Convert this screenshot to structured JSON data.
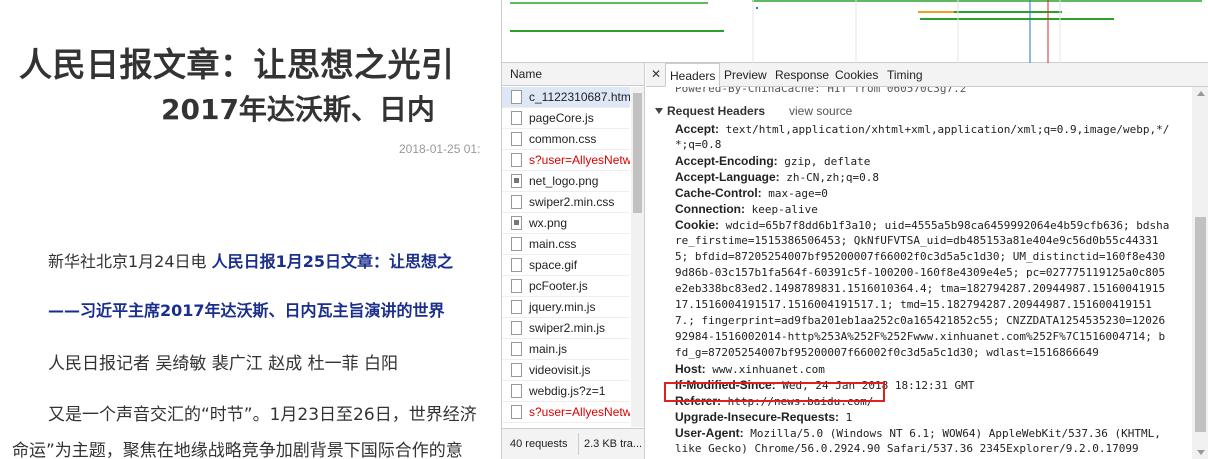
{
  "article": {
    "title_line1": "人民日报文章：让思想之光引",
    "title_line2": "2017年达沃斯、日内",
    "date": "2018-01-25 01:",
    "p1_prefix": "新华社北京1月24日电 ",
    "p1_link": "人民日报1月25日文章：让思想之",
    "p2": "——习近平主席2017年达沃斯、日内瓦主旨演讲的世界",
    "p3": "人民日报记者 吴绮敏 裴广江 赵成 杜一菲 白阳",
    "p4": "又是一个声音交汇的“时节”。1月23日至26日，世界经济",
    "p5": "命运”为主题，聚焦在地缘战略竞争加剧背景下国际合作的意"
  },
  "devtools": {
    "network_list": {
      "header": "Name",
      "rows": [
        {
          "name": "c_1122310687.htm",
          "selected": true,
          "error": false,
          "icon": "document-icon"
        },
        {
          "name": "pageCore.js",
          "selected": false,
          "error": false,
          "icon": "document-icon"
        },
        {
          "name": "common.css",
          "selected": false,
          "error": false,
          "icon": "document-icon"
        },
        {
          "name": "s?user=AllyesNetw",
          "selected": false,
          "error": true,
          "icon": "document-icon"
        },
        {
          "name": "net_logo.png",
          "selected": false,
          "error": false,
          "icon": "image-icon"
        },
        {
          "name": "swiper2.min.css",
          "selected": false,
          "error": false,
          "icon": "document-icon"
        },
        {
          "name": "wx.png",
          "selected": false,
          "error": false,
          "icon": "image-icon"
        },
        {
          "name": "main.css",
          "selected": false,
          "error": false,
          "icon": "document-icon"
        },
        {
          "name": "space.gif",
          "selected": false,
          "error": false,
          "icon": "document-icon"
        },
        {
          "name": "pcFooter.js",
          "selected": false,
          "error": false,
          "icon": "document-icon"
        },
        {
          "name": "jquery.min.js",
          "selected": false,
          "error": false,
          "icon": "document-icon"
        },
        {
          "name": "swiper2.min.js",
          "selected": false,
          "error": false,
          "icon": "document-icon"
        },
        {
          "name": "main.js",
          "selected": false,
          "error": false,
          "icon": "document-icon"
        },
        {
          "name": "videovisit.js",
          "selected": false,
          "error": false,
          "icon": "document-icon"
        },
        {
          "name": "webdig.js?z=1",
          "selected": false,
          "error": false,
          "icon": "document-icon"
        },
        {
          "name": "s?user=AllyesNetw",
          "selected": false,
          "error": true,
          "icon": "document-icon"
        }
      ],
      "footer_requests": "40 requests",
      "footer_transferred": "2.3 KB tra..."
    },
    "tabs": [
      "Headers",
      "Preview",
      "Response",
      "Cookies",
      "Timing"
    ],
    "active_tab": "Headers",
    "close_glyph": "✕",
    "headers": {
      "partial_top_line": "Powered-By-ChinaCache: HIT from 060570c3g7.2",
      "section_title": "Request Headers",
      "view_source": "view source",
      "accept_key": "Accept:",
      "accept_value_1": " text/html,application/xhtml+xml,application/xml;q=0.9,image/webp,*/",
      "accept_value_2": "*;q=0.8",
      "encoding_key": "Accept-Encoding:",
      "encoding_value": " gzip, deflate",
      "language_key": "Accept-Language:",
      "language_value": " zh-CN,zh;q=0.8",
      "cache_key": "Cache-Control:",
      "cache_value": " max-age=0",
      "connection_key": "Connection:",
      "connection_value": " keep-alive",
      "cookie_key": "Cookie:",
      "cookie_lines": [
        " wdcid=65b7f8dd6b1f3a10; uid=4555a5b98ca6459992064e4b59cfb636; bdsha",
        "re_firstime=1515386506453; QkNfUFVTSA_uid=db485153a81e404e9c56d0b55c44331",
        "5; bfdid=87205254007bf95200007f66002f0c3d5a5c1d30; UM_distinctid=160f8e430",
        "9d86b-03c157b1fa564f-60391c5f-100200-160f8e4309e4e5; pc=027775119125a0c805",
        "e2eb338bc83ed2.1498789831.1516010364.4; tma=182794287.20944987.15160041915",
        "17.1516004191517.1516004191517.1; tmd=15.182794287.20944987.151600419151",
        "7.; fingerprint=ad9fba201eb1aa252c0a165421852c55; CNZZDATA1254535230=12026",
        "92984-1516002014-http%253A%252F%252Fwww.xinhuanet.com%252F%7C1516004714; b",
        "fd_g=87205254007bf95200007f66002f0c3d5a5c1d30; wdlast=1516866649"
      ],
      "host_key": "Host:",
      "host_value": " www.xinhuanet.com",
      "ifmod_key": "If-Modified-Since:",
      "ifmod_value": " Wed, 24 Jan 2018 18:12:31 GMT",
      "referer_key": "Referer:",
      "referer_value": " http://news.baidu.com/",
      "upgrade_key": "Upgrade-Insecure-Requests:",
      "upgrade_value": " 1",
      "ua_key": "User-Agent:",
      "ua_value_1": " Mozilla/5.0 (Windows NT 6.1; WOW64) AppleWebKit/537.36 (KHTML,",
      "ua_value_2": " like Gecko) Chrome/56.0.2924.90 Safari/537.36 2345Explorer/9.2.0.17099"
    }
  },
  "colors": {
    "highlight_box": "#e02020",
    "link_blue": "#1a2e8c",
    "error_red": "#dd0000"
  }
}
